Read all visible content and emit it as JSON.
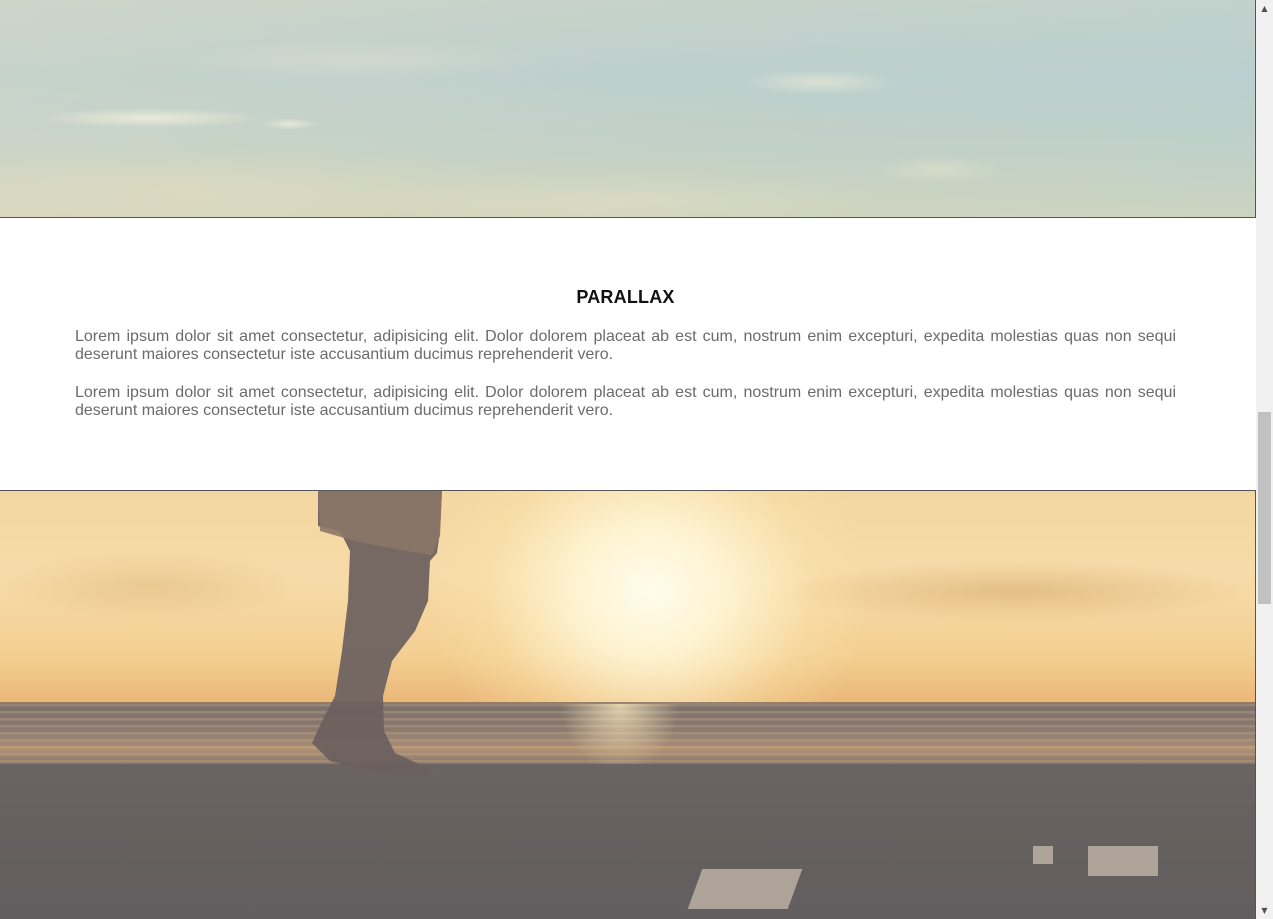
{
  "section": {
    "title": "PARALLAX",
    "paragraphs": [
      "Lorem ipsum dolor sit amet consectetur, adipisicing elit. Dolor dolorem placeat ab est cum, nostrum enim excepturi, expedita molestias quas non sequi deserunt maiores consectetur iste accusantium ducimus reprehenderit vero.",
      "Lorem ipsum dolor sit amet consectetur, adipisicing elit. Dolor dolorem placeat ab est cum, nostrum enim excepturi, expedita molestias quas non sequi deserunt maiores consectetur iste accusantium ducimus reprehenderit vero."
    ]
  },
  "images": {
    "top": "sky-clouds",
    "bottom": "beach-sunset-walker"
  },
  "scrollbar": {
    "up_icon": "▲",
    "down_icon": "▼",
    "position": 0.49
  },
  "colors": {
    "title": "#111111",
    "paragraph": "#6b6b6b",
    "background": "#ffffff"
  }
}
